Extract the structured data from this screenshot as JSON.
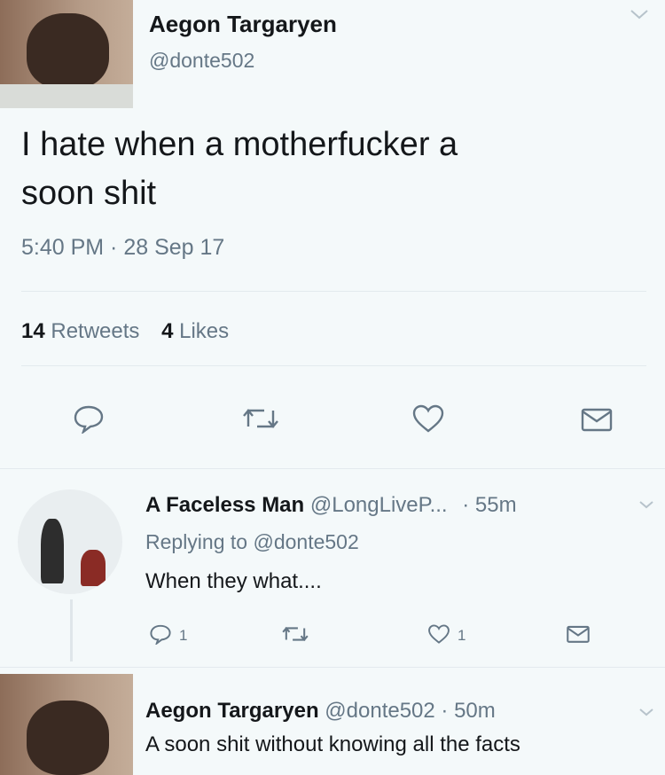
{
  "tweet": {
    "author_name": "Aegon Targaryen",
    "author_handle": "@donte502",
    "text_line1": "I hate when a motherfucker a",
    "text_line2": "soon shit",
    "timestamp": "5:40 PM · 28 Sep 17",
    "retweets_count": "14",
    "retweets_label": "Retweets",
    "likes_count": "4",
    "likes_label": "Likes"
  },
  "reply1": {
    "author_name": "A Faceless Man",
    "author_handle": "@LongLiveP...",
    "time": "· 55m",
    "replying_prefix": "Replying to",
    "replying_handle": "@donte502",
    "text": "When they what....",
    "reply_count": "1",
    "like_count": "1"
  },
  "reply2": {
    "author_name": "Aegon Targaryen",
    "author_handle": "@donte502",
    "time": "· 50m",
    "text": "A soon shit without knowing all the facts"
  },
  "icons": {
    "reply": "reply-icon",
    "retweet": "retweet-icon",
    "like": "heart-icon",
    "dm": "envelope-icon",
    "caret": "chevron-down-icon"
  }
}
